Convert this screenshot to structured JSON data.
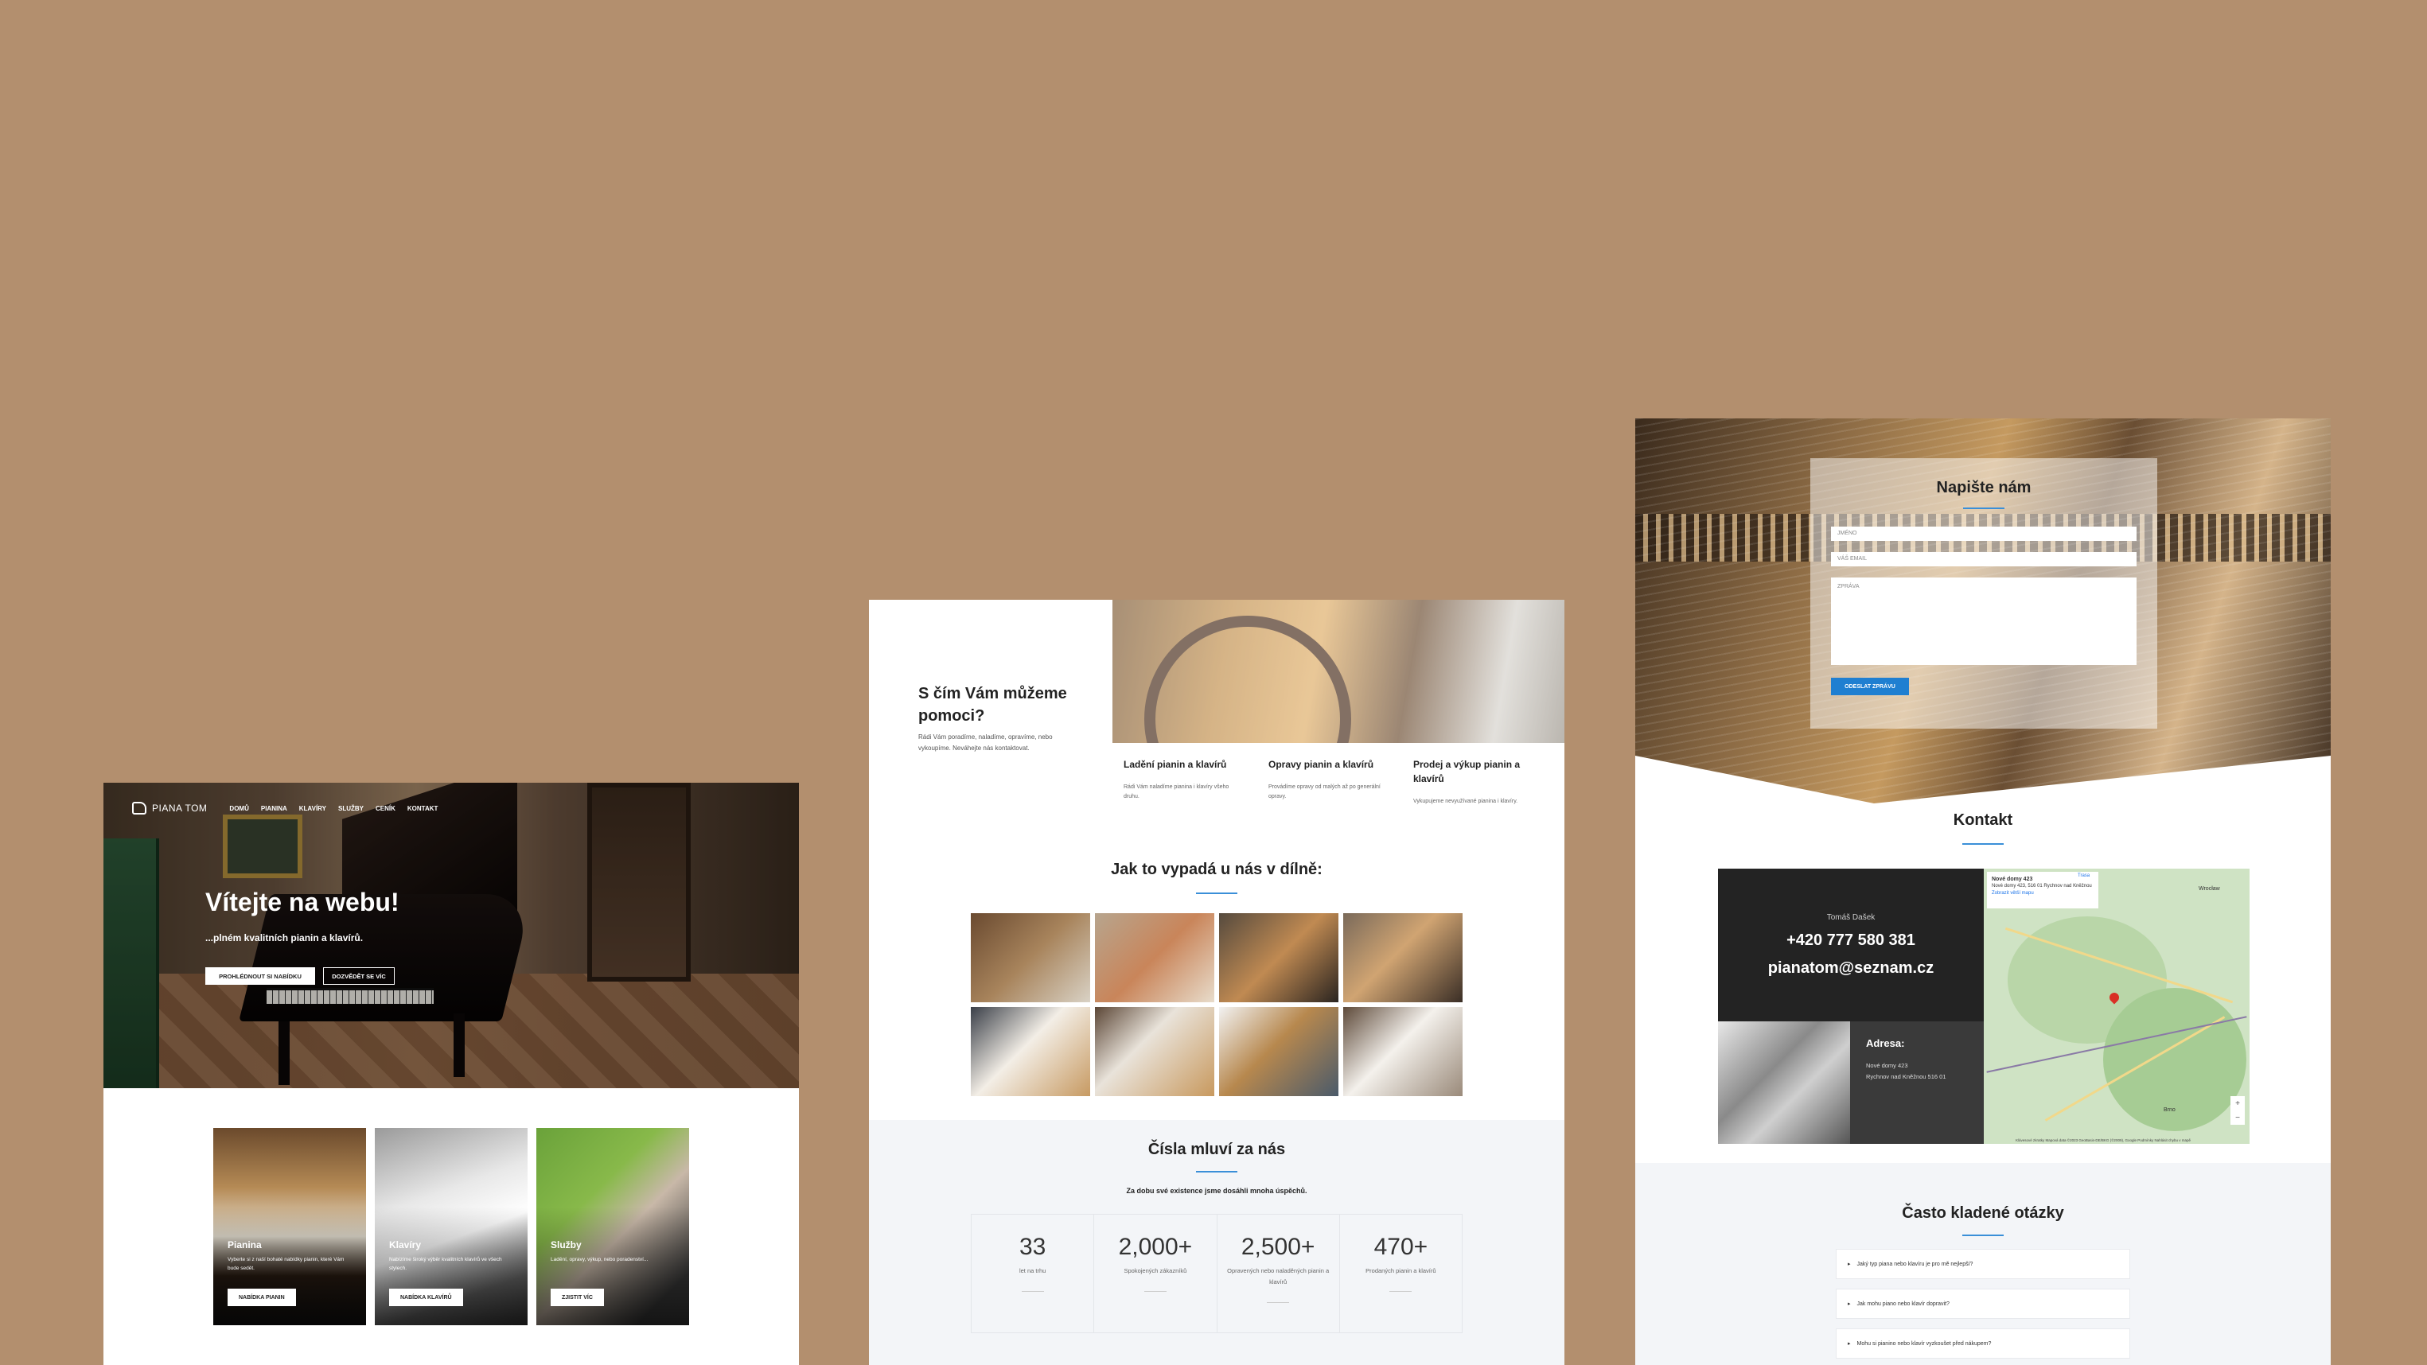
{
  "panel1": {
    "logo_text": "PIANA TOM",
    "nav": [
      "DOMŮ",
      "PIANINA",
      "KLAVÍRY",
      "SLUŽBY",
      "CENÍK",
      "KONTAKT"
    ],
    "hero_title": "Vítejte na webu!",
    "hero_subtitle": "...plném kvalitních pianin a klavírů.",
    "btn_browse": "PROHLÉDNOUT SI NABÍDKU",
    "btn_more": "DOZVĚDĚT SE VÍC",
    "cards": [
      {
        "title": "Pianina",
        "desc": "Vyberte si z naší bohaté nabídky pianin, které Vám bude sedět.",
        "button": "NABÍDKA PIANIN"
      },
      {
        "title": "Klavíry",
        "desc": "Nabízíme široký výběr kvalitních klavírů ve všech stylech.",
        "button": "NABÍDKA KLAVÍRŮ"
      },
      {
        "title": "Služby",
        "desc": "Ladění, opravy, výkup, nebo poradenství...",
        "button": "ZJISTIT VÍC"
      }
    ]
  },
  "panel2": {
    "help_title": "S čím Vám můžeme pomoci?",
    "help_text": "Rádi Vám poradíme, naladíme, opravíme, nebo vykoupíme. Neváhejte nás kontaktovat.",
    "services": [
      {
        "title": "Ladění pianin a klavírů",
        "desc": "Rádi Vám naladíme pianina i klavíry všeho druhu."
      },
      {
        "title": "Opravy pianin a klavírů",
        "desc": "Provádíme opravy od malých až po generální opravy."
      },
      {
        "title": "Prodej a výkup pianin a klavírů",
        "desc": "Vykupujeme nevyužívané pianina i klavíry."
      }
    ],
    "gallery_title": "Jak to vypadá u nás v dílně:",
    "stats_title": "Čísla mluví za nás",
    "stats_subtitle": "Za dobu své existence jsme dosáhli mnoha úspěchů.",
    "stats": [
      {
        "num": "33",
        "label": "let na trhu"
      },
      {
        "num": "2,000+",
        "label": "Spokojených zákazníků"
      },
      {
        "num": "2,500+",
        "label": "Opravených nebo naladěných pianin a klavírů"
      },
      {
        "num": "470+",
        "label": "Prodaných pianin a klavírů"
      }
    ]
  },
  "panel3": {
    "form_title": "Napište nám",
    "name_placeholder": "JMÉNO",
    "email_placeholder": "VÁŠ EMAIL",
    "message_placeholder": "ZPRÁVA",
    "send_label": "ODESLAT ZPRÁVU",
    "contact_title": "Kontakt",
    "person": "Tomáš Dašek",
    "phone": "+420 777 580 381",
    "email": "pianatom@seznam.cz",
    "address_title": "Adresa:",
    "address_line1": "Nové domy 423",
    "address_line2": "Rychnov nad Kněžnou 516 01",
    "map": {
      "place": "Nové domy 423",
      "place_addr": "Nové domy 423, 516 01 Rychnov nad Kněžnou",
      "larger_map": "Zobrazit větší mapu",
      "directions": "Trasa",
      "label_wroclaw": "Wrocław",
      "label_brno": "Brno",
      "footer": "Klávesové zkratky  Mapová data ©2023 GeoBasis-DE/BKG (©2009), Google  Podmínky  Nahlásit chybu v mapě"
    },
    "faq_title": "Často kladené otázky",
    "faq": [
      "Jaký typ piana nebo klavíru je pro mě nejlepší?",
      "Jak mohu piano nebo klavír dopravit?",
      "Mohu si pianino nebo klavír vyzkoušet před nákupem?"
    ]
  },
  "colors": {
    "background": "#b38f6e",
    "accent": "#1f7fd1",
    "dark": "#232323"
  }
}
